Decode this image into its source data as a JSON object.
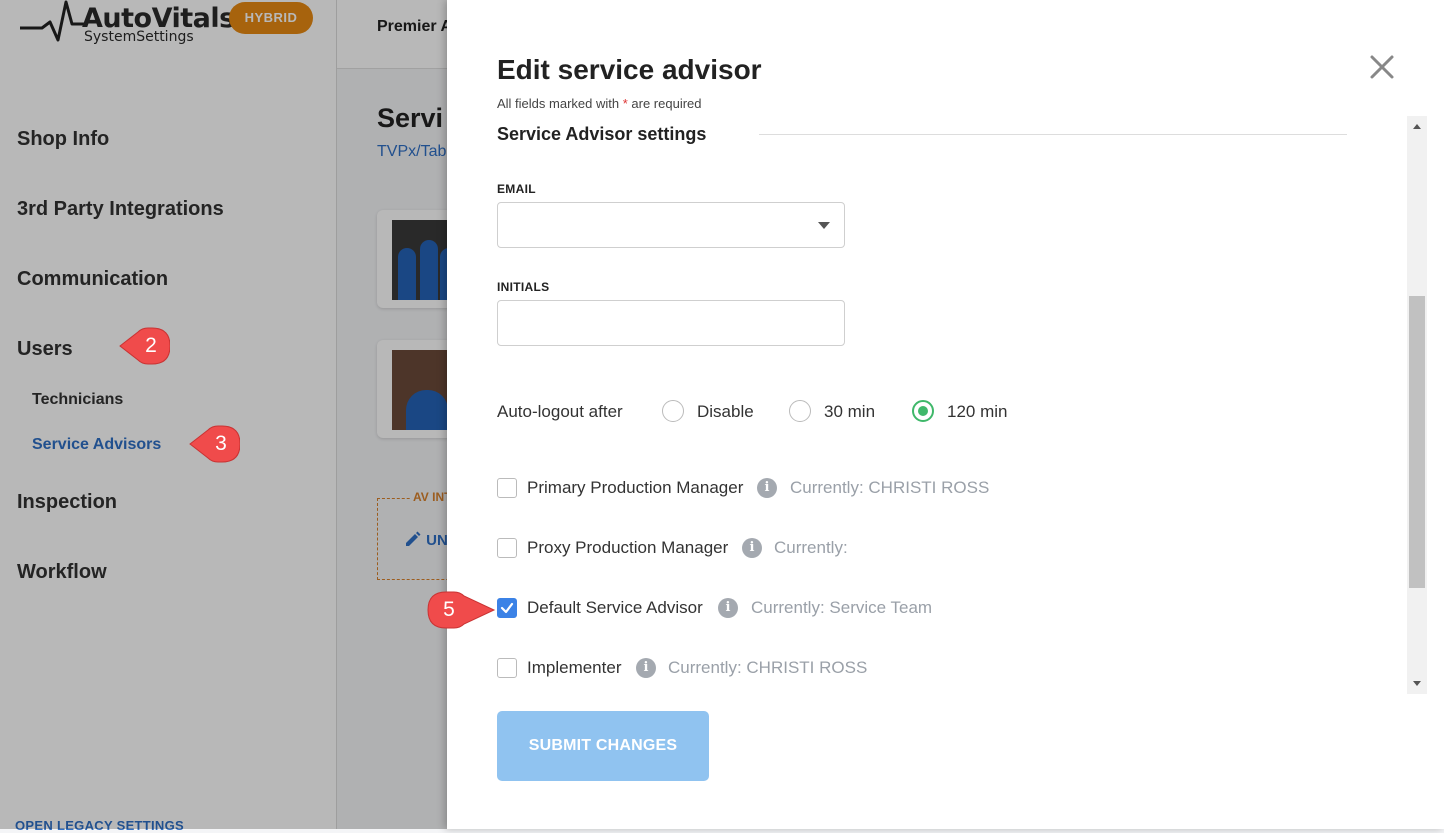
{
  "app": {
    "logo_name": "AutoVitals",
    "logo_sub": "SystemSettings",
    "badge": "HYBRID"
  },
  "sidebar": {
    "items": [
      {
        "label": "Shop Info"
      },
      {
        "label": "3rd Party Integrations"
      },
      {
        "label": "Communication"
      },
      {
        "label": "Users"
      },
      {
        "label": "Inspection"
      },
      {
        "label": "Workflow"
      }
    ],
    "sub_items": [
      {
        "label": "Technicians"
      },
      {
        "label": "Service Advisors",
        "active": true
      }
    ],
    "legacy_link": "OPEN LEGACY SETTINGS"
  },
  "callouts": [
    "2",
    "3",
    "5"
  ],
  "main": {
    "header_text": "Premier A",
    "page_title": "Servi",
    "page_sub": "TVPx/Tab",
    "av_label": "AV INT",
    "av_edit": "UN"
  },
  "modal": {
    "title": "Edit service advisor",
    "note_prefix": "All fields marked with ",
    "note_star": "*",
    "note_suffix": " are required",
    "section_title": "Service Advisor settings",
    "email_label": "EMAIL",
    "email_value": "",
    "initials_label": "INITIALS",
    "initials_value": "",
    "autologout_label": "Auto-logout after",
    "radio_options": [
      {
        "label": "Disable",
        "checked": false
      },
      {
        "label": "30 min",
        "checked": false
      },
      {
        "label": "120 min",
        "checked": true
      }
    ],
    "checkboxes": [
      {
        "label": "Primary Production Manager",
        "checked": false,
        "current": "Currently: CHRISTI ROSS"
      },
      {
        "label": "Proxy Production Manager",
        "checked": false,
        "current": "Currently:"
      },
      {
        "label": "Default Service Advisor",
        "checked": true,
        "current": "Currently: Service Team"
      },
      {
        "label": "Implementer",
        "checked": false,
        "current": "Currently: CHRISTI ROSS"
      }
    ],
    "info_glyph": "i",
    "submit_label": "SUBMIT CHANGES"
  },
  "colors": {
    "accent_blue": "#2f6fc5",
    "badge_orange": "#e88a12",
    "radio_green": "#3fb86a",
    "checkbox_blue": "#3b82e6",
    "submit_disabled": "#90c3f0",
    "callout_red": "#f04b4b"
  }
}
